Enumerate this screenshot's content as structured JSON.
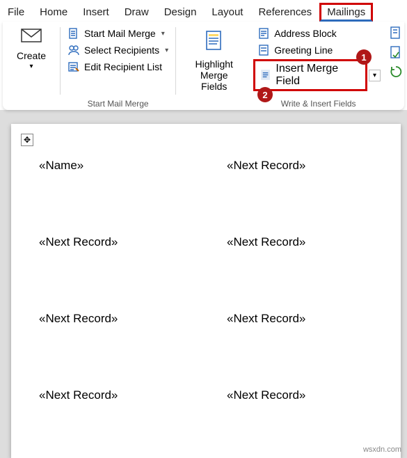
{
  "tabs": {
    "file": "File",
    "home": "Home",
    "insert": "Insert",
    "draw": "Draw",
    "design": "Design",
    "layout": "Layout",
    "references": "References",
    "mailings": "Mailings"
  },
  "ribbon": {
    "create": {
      "label": "Create"
    },
    "mailmerge": {
      "start": "Start Mail Merge",
      "select": "Select Recipients",
      "edit": "Edit Recipient List",
      "group_label": "Start Mail Merge"
    },
    "highlight": {
      "line1": "Highlight",
      "line2": "Merge Fields"
    },
    "wif": {
      "address": "Address Block",
      "greeting": "Greeting Line",
      "insert": "Insert Merge Field",
      "group_label": "Write & Insert Fields"
    }
  },
  "badges": {
    "one": "1",
    "two": "2"
  },
  "doc": {
    "fields": [
      "«Name»",
      "«Next Record»",
      "«Next Record»",
      "«Next Record»",
      "«Next Record»",
      "«Next Record»",
      "«Next Record»",
      "«Next Record»"
    ]
  },
  "watermark": "wsxdn.com"
}
